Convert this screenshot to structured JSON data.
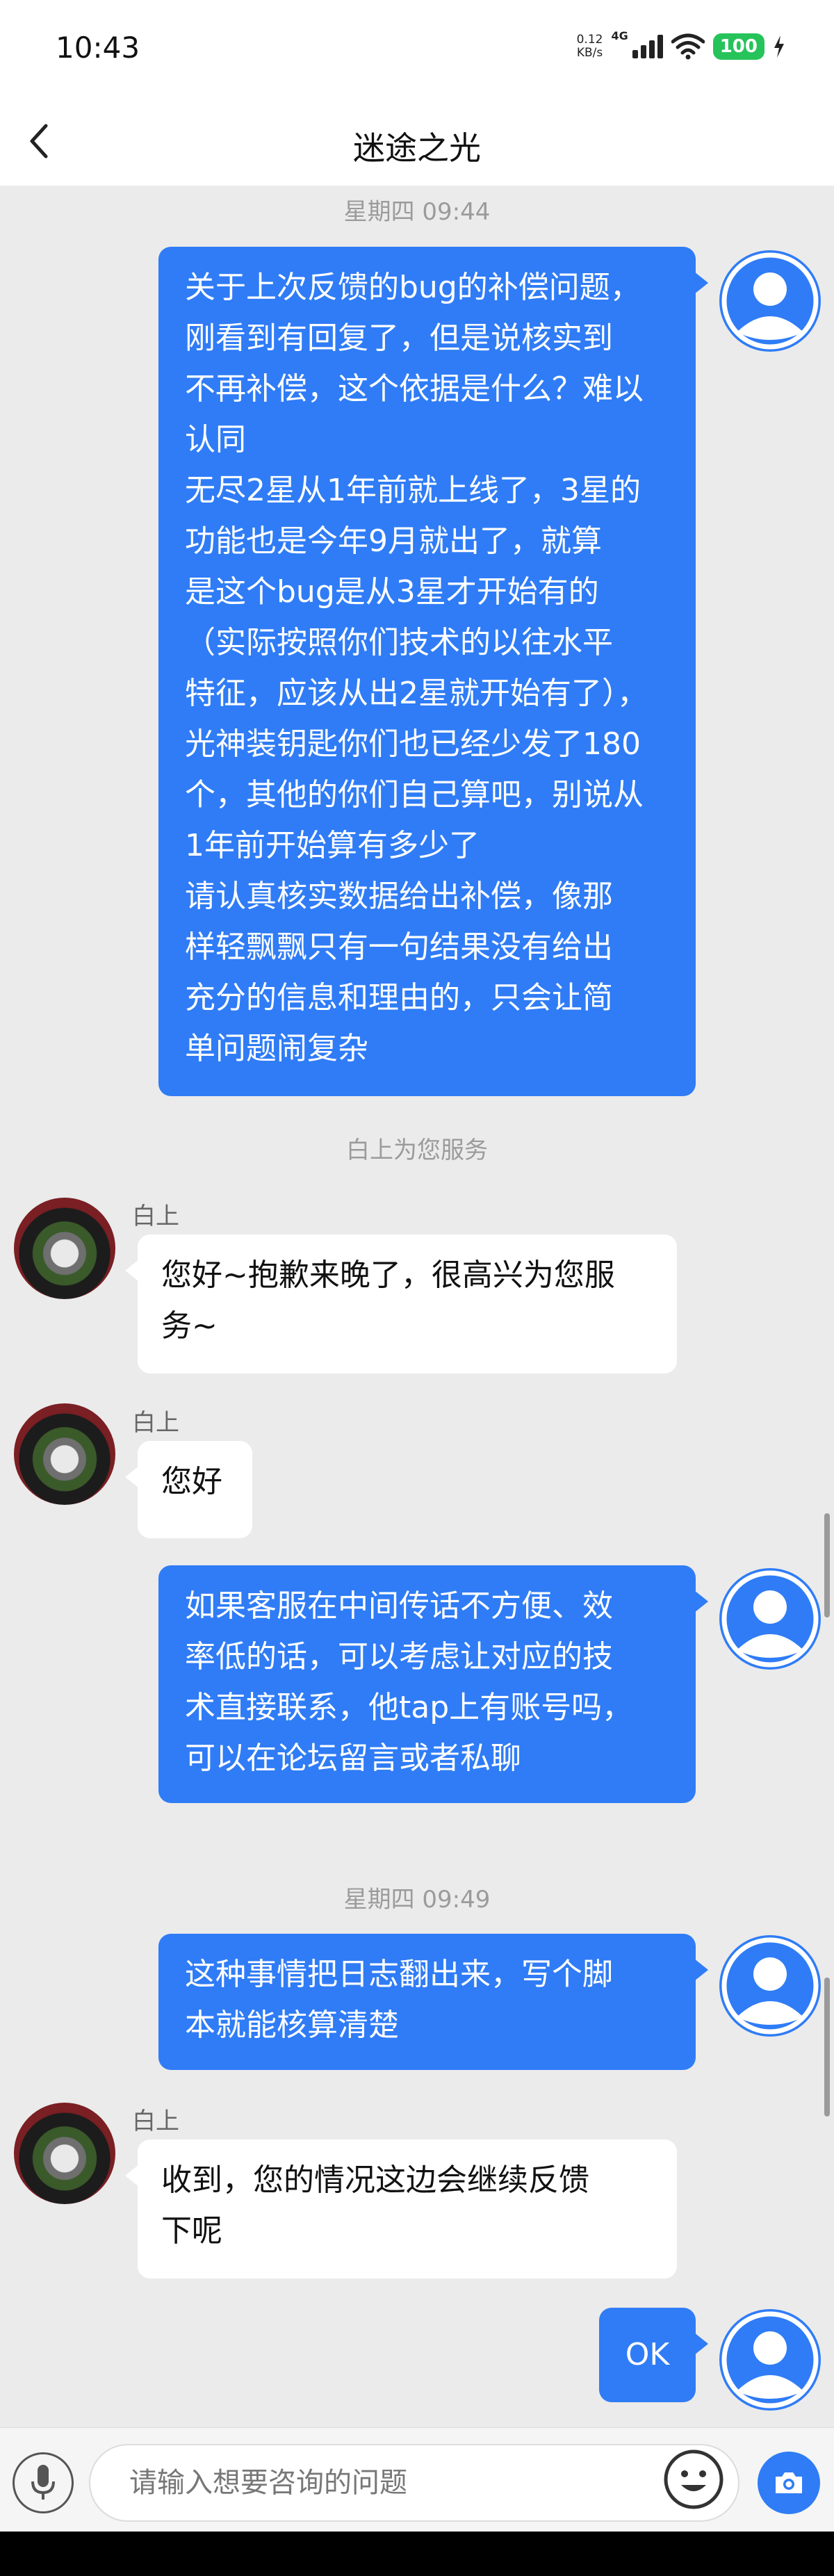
{
  "status_bar": {
    "time": "10:43",
    "net_speed_value": "0.12",
    "net_speed_unit": "KB/s",
    "signal_label": "4G",
    "battery": "100"
  },
  "nav": {
    "title": "迷途之光",
    "back_icon": "chevron-left-icon"
  },
  "messages": {
    "ts1": "星期四 09:44",
    "m1_lines": [
      "关于上次反馈的bug的补偿问题，",
      "刚看到有回复了，但是说核实到",
      "不再补偿，这个依据是什么？难以",
      "认同",
      "无尽2星从1年前就上线了，3星的",
      "功能也是今年9月就出了，就算",
      "是这个bug是从3星才开始有的",
      "（实际按照你们技术的以往水平",
      "特征，应该从出2星就开始有了），",
      "光神装钥匙你们也已经少发了180",
      "个，其他的你们自己算吧，别说从",
      "1年前开始算有多少了",
      "请认真核实数据给出补偿，像那",
      "样轻飘飘只有一句结果没有给出",
      "充分的信息和理由的，只会让简",
      "单问题闹复杂"
    ],
    "service_notice": "白上为您服务",
    "agent_name": "白上",
    "m2_lines": [
      "您好~抱歉来晚了，很高兴为您服",
      "务~"
    ],
    "m3": "您好",
    "m4_lines": [
      "如果客服在中间传话不方便、效",
      "率低的话，可以考虑让对应的技",
      "术直接联系，他tap上有账号吗，",
      "可以在论坛留言或者私聊"
    ],
    "ts2": "星期四 09:49",
    "m5_lines": [
      "这种事情把日志翻出来，写个脚",
      "本就能核算清楚"
    ],
    "m6_lines": [
      "收到，您的情况这边会继续反馈",
      "下呢"
    ],
    "m7": "OK"
  },
  "input": {
    "placeholder": "请输入想要咨询的问题",
    "value": ""
  },
  "colors": {
    "accent": "#2f7cf6",
    "chat_bg": "#ebebeb",
    "bubble_left": "#ffffff",
    "battery": "#26c35a"
  }
}
